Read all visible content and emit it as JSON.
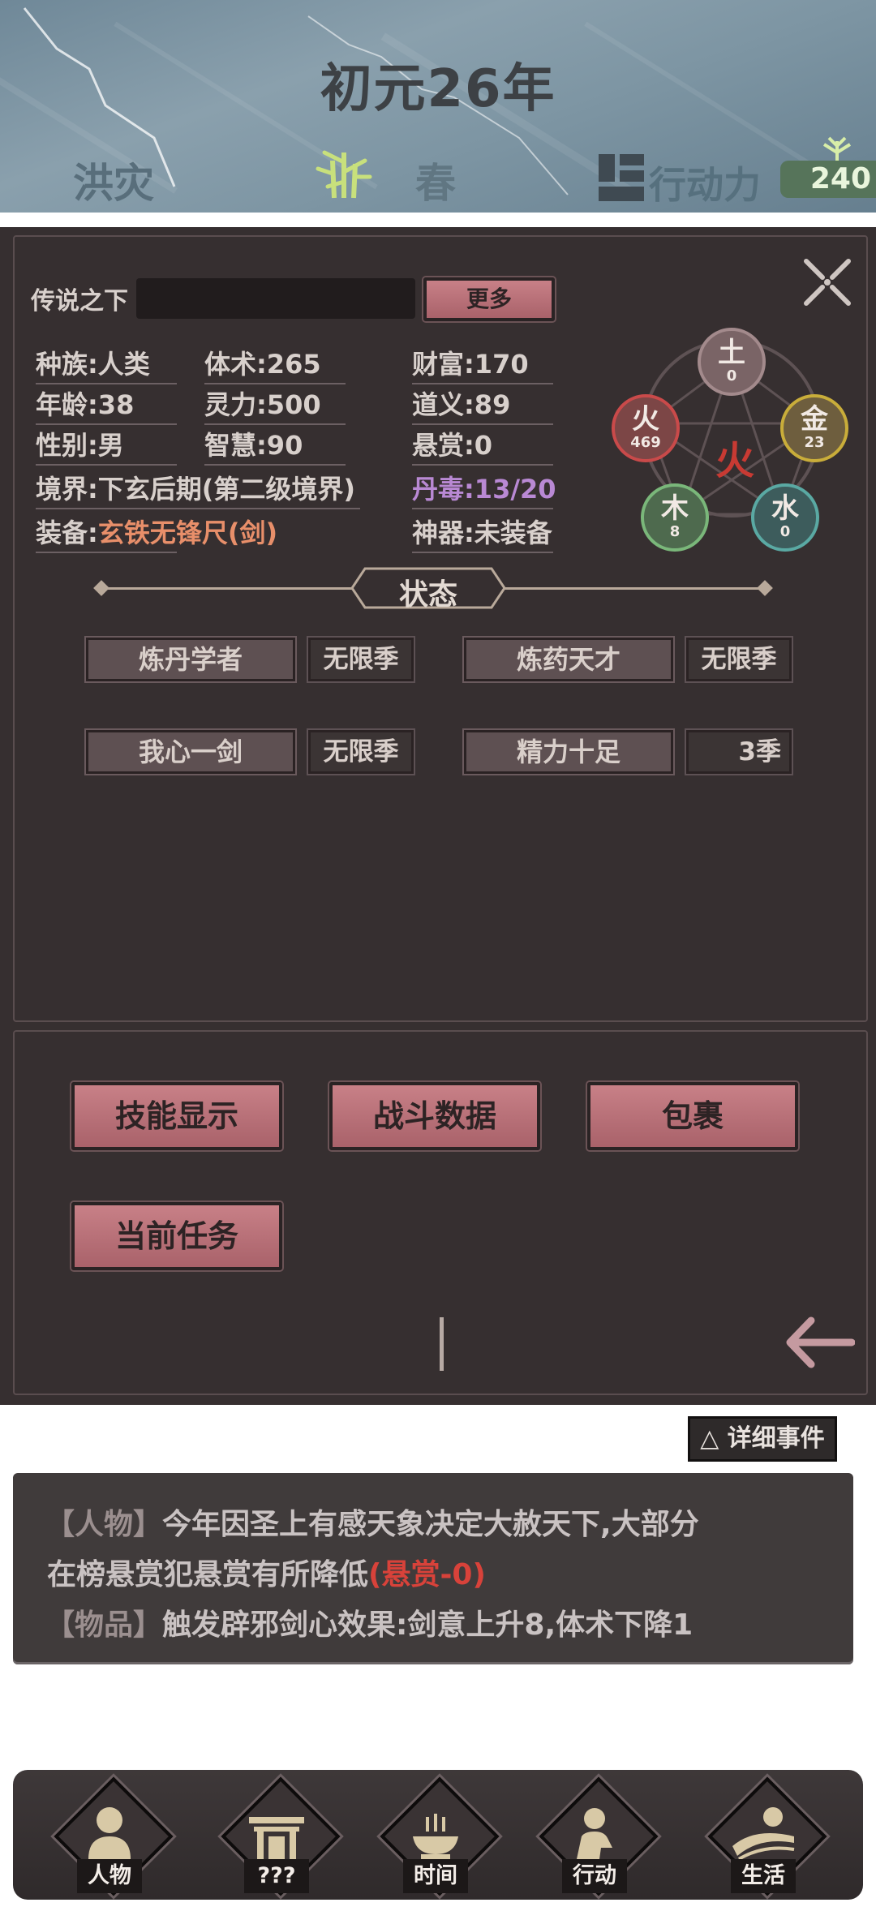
{
  "header": {
    "year": "初元26年",
    "disaster": "洪灾",
    "season_icon": "bamboo-icon",
    "season": "春",
    "action_icon": "action-glyph-icon",
    "action_label": "行动力",
    "action_value": "240"
  },
  "profile": {
    "title": "传说之下",
    "name_value": "",
    "more_label": "更多"
  },
  "stats": {
    "race": "种族:人类",
    "age": "年龄:38",
    "gender": "性别:男",
    "realm": "境界:下玄后期(第二级境界)",
    "equip_prefix": "装备:",
    "equip_value": "玄铁无锋尺(剑)",
    "body": "体术:265",
    "spirit": "灵力:500",
    "wisdom": "智慧:90",
    "wealth": "财富:170",
    "righteousness": "道义:89",
    "bounty": "悬赏:0",
    "poison": "丹毒:13/20",
    "artifact": "神器:未装备"
  },
  "elements": {
    "center": "火",
    "earth": {
      "name": "土",
      "value": "0"
    },
    "metal": {
      "name": "金",
      "value": "23"
    },
    "water": {
      "name": "水",
      "value": "0"
    },
    "wood": {
      "name": "木",
      "value": "8"
    },
    "fire": {
      "name": "火",
      "value": "469"
    }
  },
  "status": {
    "heading": "状态",
    "items": [
      {
        "name": "炼丹学者",
        "duration": "无限季"
      },
      {
        "name": "炼药天才",
        "duration": "无限季"
      },
      {
        "name": "我心一剑",
        "duration": "无限季"
      },
      {
        "name": "精力十足",
        "duration": "3季"
      }
    ]
  },
  "actions": {
    "skills": "技能显示",
    "battle": "战斗数据",
    "bag": "包裹",
    "quest": "当前任务"
  },
  "events": {
    "toggle_label": "△ 详细事件",
    "line1_tag": "【人物】",
    "line1_text": "今年因圣上有感天象决定大赦天下,大部分",
    "line2_text": "在榜悬赏犯悬赏有所降低",
    "line2_highlight": "(悬赏-0)",
    "line3_tag": "【物品】",
    "line3_text": "触发辟邪剑心效果:剑意上升8,体术下降1"
  },
  "nav": {
    "items": [
      {
        "label": "人物",
        "icon": "person-icon"
      },
      {
        "label": "???",
        "icon": "shrine-icon"
      },
      {
        "label": "时间",
        "icon": "incense-burner-icon"
      },
      {
        "label": "行动",
        "icon": "action-person-icon"
      },
      {
        "label": "生活",
        "icon": "landscape-icon"
      }
    ]
  },
  "colors": {
    "accent_pink": "#c07a82",
    "highlight_orange": "#e88f6a",
    "poison_purple": "#b989d4",
    "bounty_red": "#d8423a",
    "fire_center": "#c83a33"
  }
}
